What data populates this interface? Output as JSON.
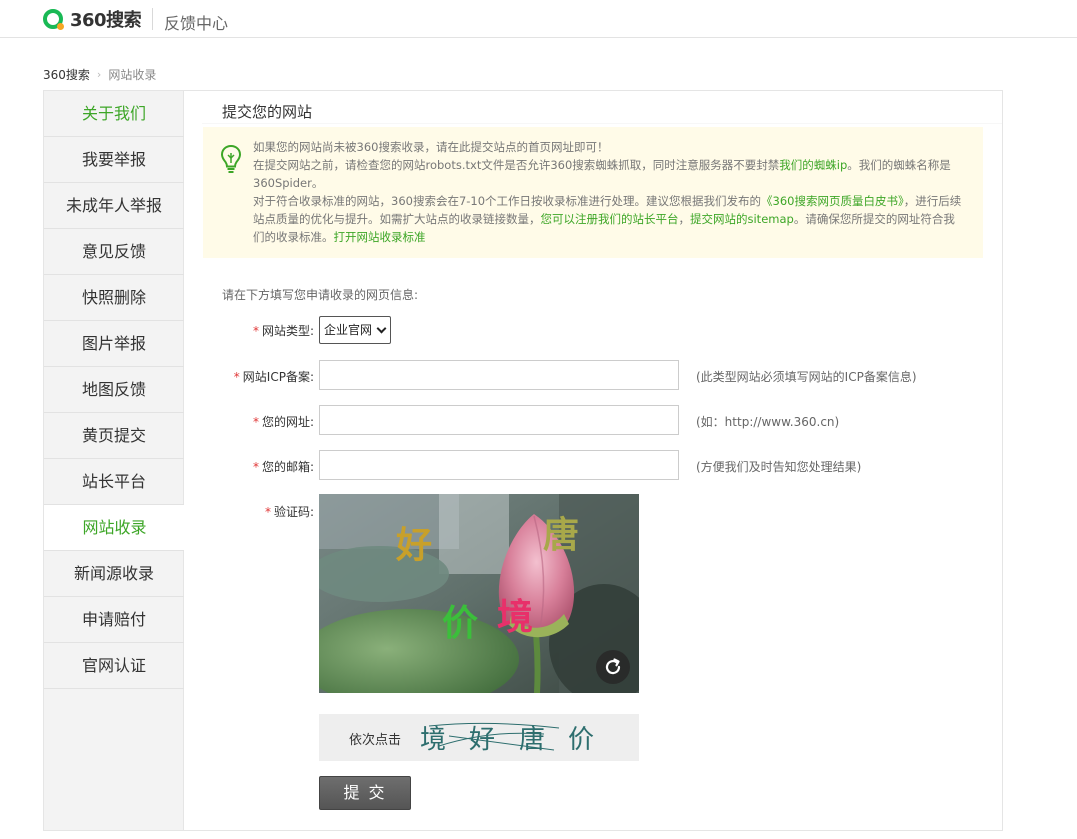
{
  "header": {
    "logo_text": "360搜索",
    "title": "反馈中心"
  },
  "breadcrumb": {
    "home": "360搜索",
    "current": "网站收录"
  },
  "sidebar": {
    "items": [
      {
        "label": "关于我们"
      },
      {
        "label": "我要举报"
      },
      {
        "label": "未成年人举报"
      },
      {
        "label": "意见反馈"
      },
      {
        "label": "快照删除"
      },
      {
        "label": "图片举报"
      },
      {
        "label": "地图反馈"
      },
      {
        "label": "黄页提交"
      },
      {
        "label": "站长平台"
      },
      {
        "label": "网站收录"
      },
      {
        "label": "新闻源收录"
      },
      {
        "label": "申请赔付"
      },
      {
        "label": "官网认证"
      }
    ]
  },
  "main": {
    "title": "提交您的网站",
    "notice": {
      "line1": "如果您的网站尚未被360搜索收录，请在此提交站点的首页网址即可！",
      "line2_a": "在提交网站之前，请检查您的网站robots.txt文件是否允许360搜索蜘蛛抓取，同时注意服务器不要封禁",
      "line2_link": "我们的蜘蛛ip",
      "line2_b": "。我们的蜘蛛名称是360Spider。",
      "line3_a": "对于符合收录标准的网站，360搜索会在7-10个工作日按收录标准进行处理。建议您根据我们发布的",
      "line3_link1": "《360搜索网页质量白皮书》",
      "line3_b": "，进行后续站点质量的优化与提升。如需扩大站点的收录链接数量，",
      "line3_link2": "您可以注册我们的站长平台",
      "line3_c": "，",
      "line3_link3": "提交网站的sitemap",
      "line3_d": "。请确保您所提交的网址符合我们的收录标准。",
      "line3_link4": "打开网站收录标准"
    },
    "form": {
      "intro": "请在下方填写您申请收录的网页信息:",
      "required_mark": "*",
      "site_type_label": "网站类型:",
      "site_type_value": "企业官网",
      "icp_label": "网站ICP备案:",
      "icp_value": "",
      "icp_hint": "(此类型网站必须填写网站的ICP备案信息)",
      "url_label": "您的网址:",
      "url_value": "",
      "url_hint": "(如：http://www.360.cn)",
      "email_label": "您的邮箱:",
      "email_value": "",
      "email_hint": "(方便我们及时告知您处理结果)",
      "captcha_label": "验证码:",
      "captcha_chars": [
        "好",
        "唐",
        "价",
        "境"
      ],
      "captcha_char_colors": [
        "#c8a02a",
        "#a8a84a",
        "#3bbf3b",
        "#e8306a"
      ],
      "click_label": "依次点击",
      "click_sequence": [
        "境",
        "好",
        "唐",
        "价"
      ],
      "submit_label": "提 交"
    }
  },
  "colors": {
    "accent_green": "#3da627",
    "required_red": "#e03636",
    "notice_bg": "#fffbe8"
  }
}
